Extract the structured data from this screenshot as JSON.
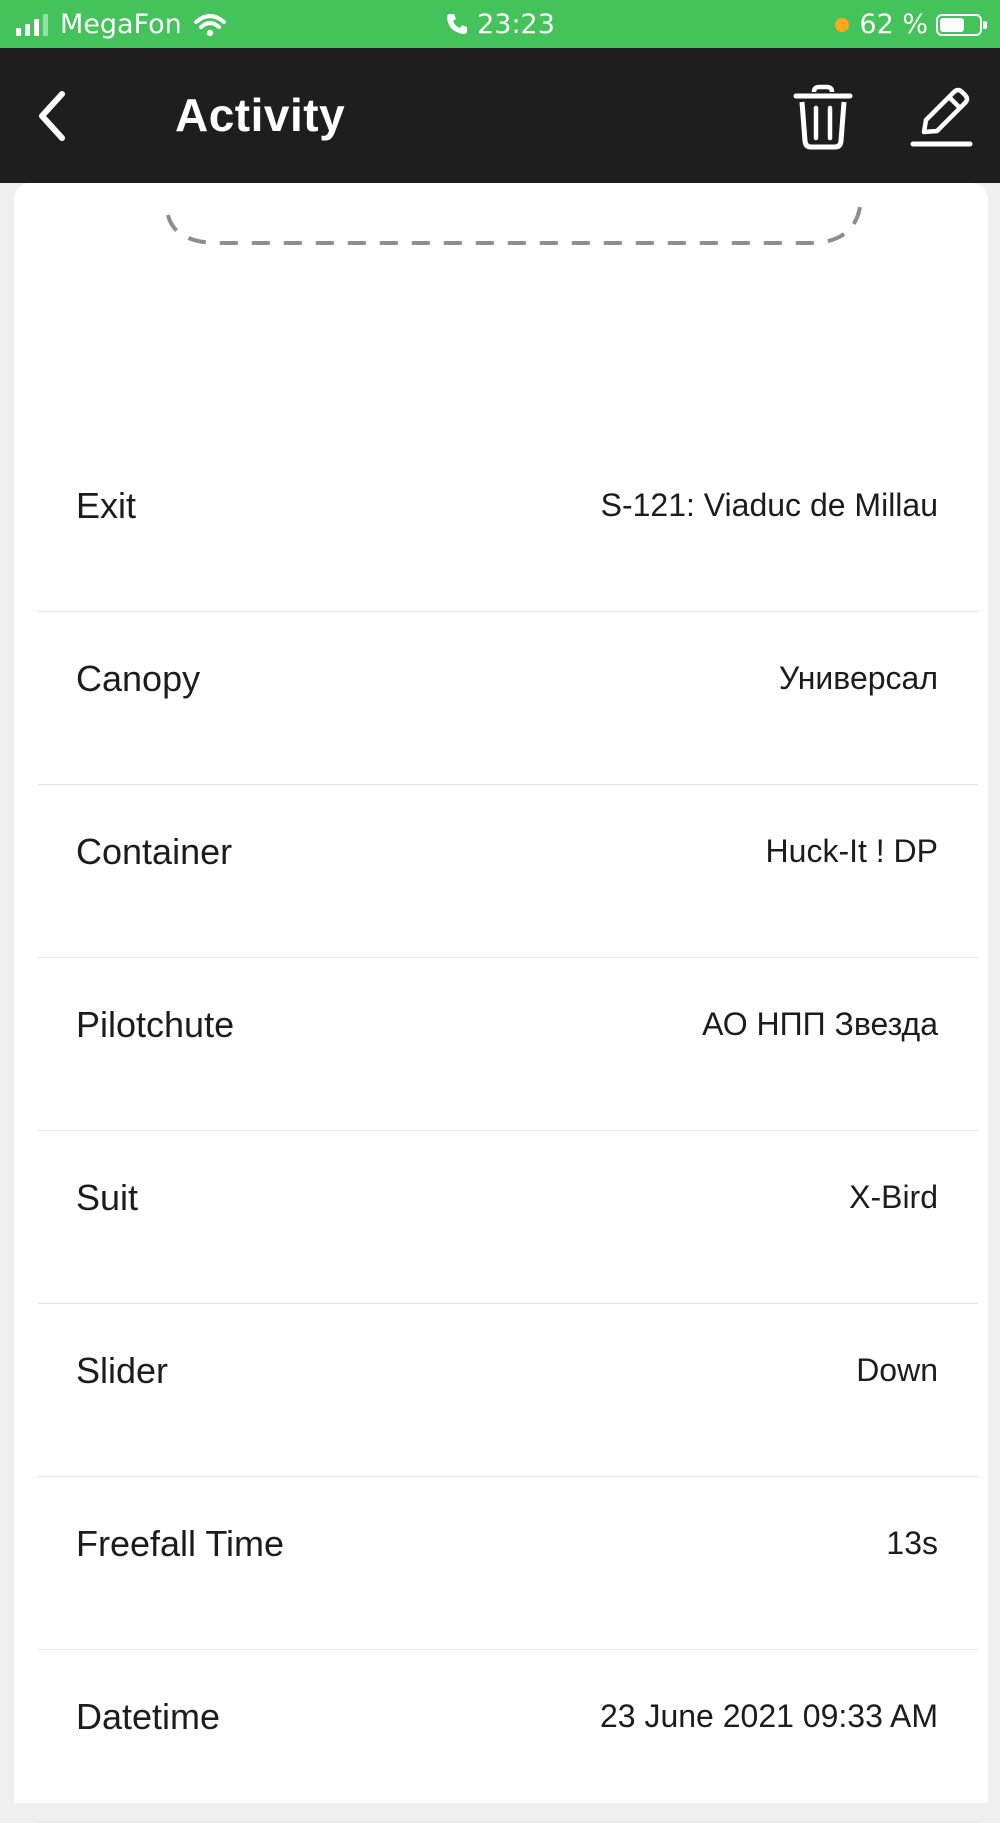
{
  "status_bar": {
    "carrier": "MegaFon",
    "time": "23:23",
    "battery": "62 %",
    "battery_level": 0.62
  },
  "header": {
    "title": "Activity",
    "back_icon": "chevron-left-icon",
    "delete_icon": "trash-icon",
    "edit_icon": "pencil-icon"
  },
  "details": [
    {
      "label": "Exit",
      "value": "S-121: Viaduc de Millau"
    },
    {
      "label": "Canopy",
      "value": "Универсал"
    },
    {
      "label": "Container",
      "value": "Huck-It ! DP"
    },
    {
      "label": "Pilotchute",
      "value": "АО НПП Звезда"
    },
    {
      "label": "Suit",
      "value": "X-Bird"
    },
    {
      "label": "Slider",
      "value": "Down"
    },
    {
      "label": "Freefall Time",
      "value": "13s"
    },
    {
      "label": "Datetime",
      "value": "23 June 2021 09:33 AM"
    }
  ],
  "colors": {
    "status_bar": "#43c35a",
    "header": "#1e1e1e",
    "background": "#efefef",
    "card": "#ffffff"
  }
}
